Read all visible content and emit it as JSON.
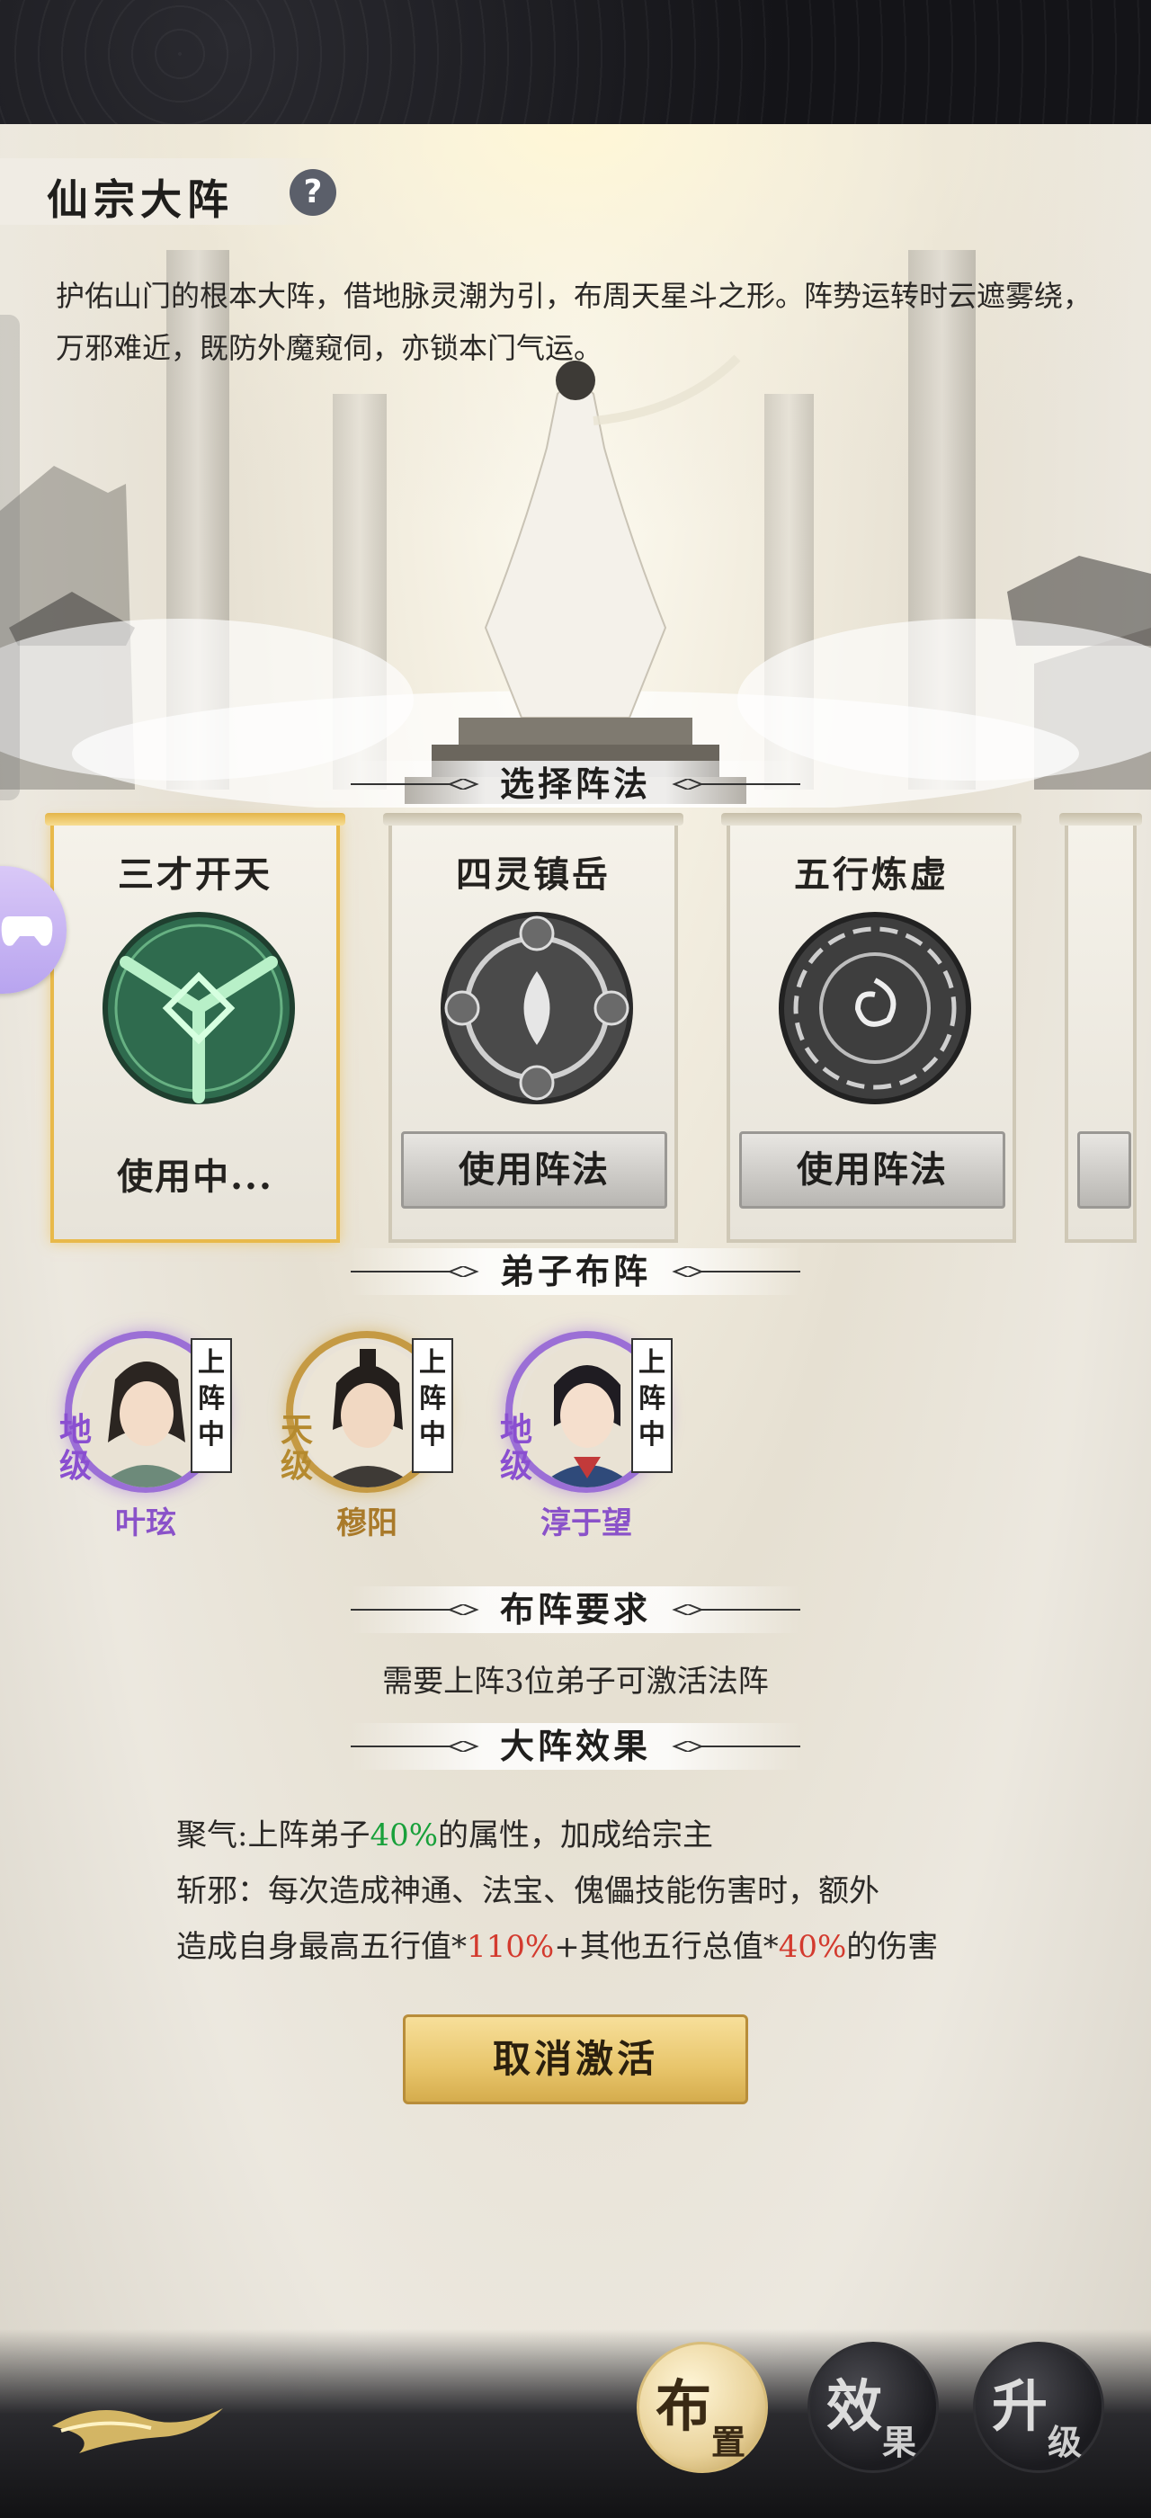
{
  "header": {
    "title": "仙宗大阵",
    "help_icon": "?",
    "description": "护佑山门的根本大阵，借地脉灵潮为引，布周天星斗之形。阵势运转时云遮雾绕，万邪难近，既防外魔窥伺，亦锁本门气运。"
  },
  "sections": {
    "select_formation": "选择阵法",
    "disciple_formation": "弟子布阵",
    "requirements": "布阵要求",
    "effects": "大阵效果"
  },
  "formations": [
    {
      "name": "三才开天",
      "status": "使用中...",
      "active": true
    },
    {
      "name": "四灵镇岳",
      "button": "使用阵法",
      "active": false
    },
    {
      "name": "五行炼虚",
      "button": "使用阵法",
      "active": false
    }
  ],
  "disciples": [
    {
      "name": "叶玹",
      "grade": "地级",
      "tag": "上阵中",
      "color": "#9b6fd6"
    },
    {
      "name": "穆阳",
      "grade": "天级",
      "tag": "上阵中",
      "color": "#c59a44"
    },
    {
      "name": "淳于望",
      "grade": "地级",
      "tag": "上阵中",
      "color": "#9b6fd6"
    }
  ],
  "requirement_text": "需要上阵3位弟子可激活法阵",
  "effects": {
    "line1_prefix": "聚气:上阵弟子",
    "line1_value": "40%",
    "line1_suffix": "的属性，加成给宗主",
    "line2": "斩邪：每次造成神通、法宝、傀儡技能伤害时，额外",
    "line3_prefix": "造成自身最高五行值*",
    "line3_value1": "110%",
    "line3_mid": "+其他五行总值*",
    "line3_value2": "40%",
    "line3_suffix": "的伤害"
  },
  "cancel_button": "取消激活",
  "bottom_nav": [
    {
      "big": "布",
      "small": "置",
      "active": true
    },
    {
      "big": "效",
      "small": "果",
      "active": false
    },
    {
      "big": "升",
      "small": "级",
      "active": false
    }
  ],
  "colors": {
    "accent_gold": "#e8b94a",
    "value_green": "#18a03a",
    "value_red": "#d33a2e",
    "grade_purple": "#9b6fd6",
    "grade_gold": "#c59a44"
  }
}
